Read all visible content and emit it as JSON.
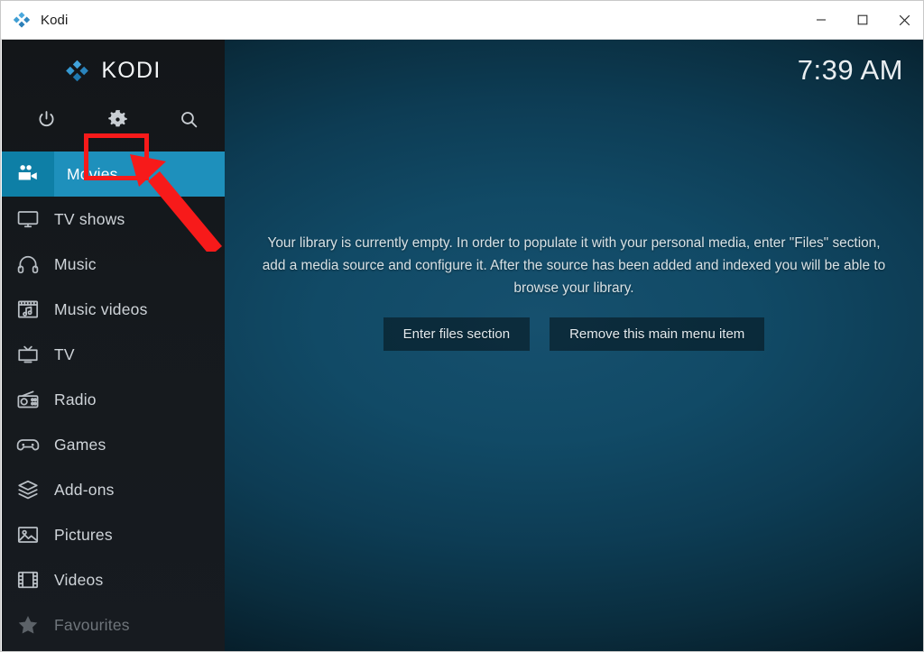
{
  "window": {
    "title": "Kodi",
    "logo_icon": "kodi-logo-icon",
    "controls": [
      {
        "name": "minimize",
        "icon": "minimize-icon"
      },
      {
        "name": "maximize",
        "icon": "maximize-icon"
      },
      {
        "name": "close",
        "icon": "close-icon"
      }
    ]
  },
  "sidebar": {
    "brand_text": "KODI",
    "brand_icon": "kodi-logo-icon",
    "actions": [
      {
        "name": "power",
        "icon": "power-icon"
      },
      {
        "name": "settings",
        "icon": "gear-icon"
      },
      {
        "name": "search",
        "icon": "search-icon"
      }
    ],
    "items": [
      {
        "label": "Movies",
        "icon": "movie-camera-icon",
        "selected": true,
        "dimmed": false
      },
      {
        "label": "TV shows",
        "icon": "tv-icon",
        "selected": false,
        "dimmed": false
      },
      {
        "label": "Music",
        "icon": "headphones-icon",
        "selected": false,
        "dimmed": false
      },
      {
        "label": "Music videos",
        "icon": "music-video-icon",
        "selected": false,
        "dimmed": false
      },
      {
        "label": "TV",
        "icon": "crt-tv-icon",
        "selected": false,
        "dimmed": false
      },
      {
        "label": "Radio",
        "icon": "radio-icon",
        "selected": false,
        "dimmed": false
      },
      {
        "label": "Games",
        "icon": "gamepad-icon",
        "selected": false,
        "dimmed": false
      },
      {
        "label": "Add-ons",
        "icon": "addons-box-icon",
        "selected": false,
        "dimmed": false
      },
      {
        "label": "Pictures",
        "icon": "picture-icon",
        "selected": false,
        "dimmed": false
      },
      {
        "label": "Videos",
        "icon": "film-strip-icon",
        "selected": false,
        "dimmed": false
      },
      {
        "label": "Favourites",
        "icon": "star-icon",
        "selected": false,
        "dimmed": true
      }
    ]
  },
  "header": {
    "clock": "7:39 AM"
  },
  "main": {
    "empty_message": "Your library is currently empty. In order to populate it with your personal media, enter \"Files\" section, add a media source and configure it. After the source has been added and indexed you will be able to browse your library.",
    "buttons": [
      {
        "label": "Enter files section"
      },
      {
        "label": "Remove this main menu item"
      }
    ]
  },
  "annotations": {
    "highlight_target": "gear-icon",
    "color": "#f71a1a"
  }
}
